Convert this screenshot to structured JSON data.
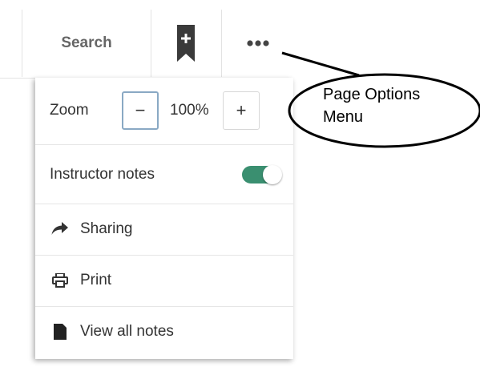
{
  "toolbar": {
    "search_label": "Search",
    "bookmark_icon": "bookmark-add-icon",
    "more_icon": "more-horizontal-icon"
  },
  "menu": {
    "zoom": {
      "label": "Zoom",
      "value": "100%",
      "minus_label": "−",
      "plus_label": "+"
    },
    "instructor_notes": {
      "label": "Instructor notes",
      "toggle_on": true
    },
    "items": [
      {
        "label": "Sharing",
        "icon": "share-arrow-icon"
      },
      {
        "label": "Print",
        "icon": "print-icon"
      },
      {
        "label": "View all notes",
        "icon": "note-icon"
      }
    ]
  },
  "annotation": {
    "line1": "Page Options",
    "line2": "Menu"
  },
  "colors": {
    "toggle_on": "#3a8f70",
    "focus_border": "#8aa9c4",
    "text": "#333333",
    "bookmark": "#3a3a3a"
  }
}
